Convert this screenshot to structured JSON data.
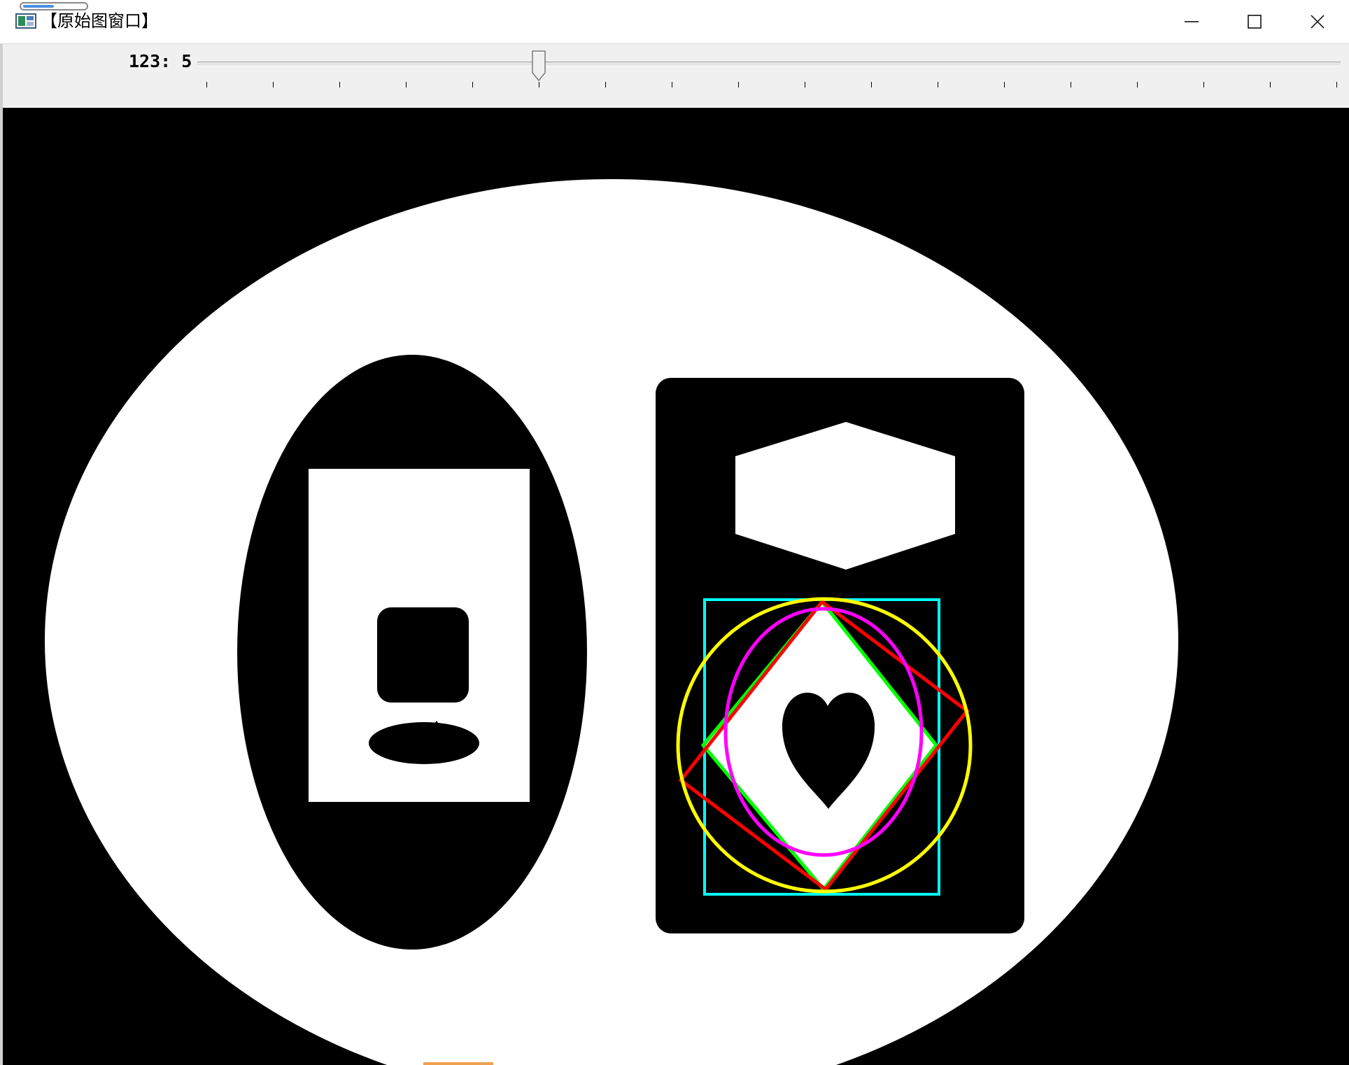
{
  "window": {
    "title": "【原始图窗口】",
    "controls": [
      "minimize",
      "maximize",
      "close"
    ]
  },
  "trackbar": {
    "label": "123: 5",
    "value": 5,
    "min": 0,
    "max": 17
  },
  "image": {
    "colors": {
      "background": "#000000",
      "shapes": "#ffffff",
      "bounding_rect": "#00ffff",
      "min_enclosing_circle": "#ffff00",
      "rotated_rect": "#ff0000",
      "approx_polygon": "#00ff00",
      "fitted_ellipse": "#ff00ff"
    }
  }
}
